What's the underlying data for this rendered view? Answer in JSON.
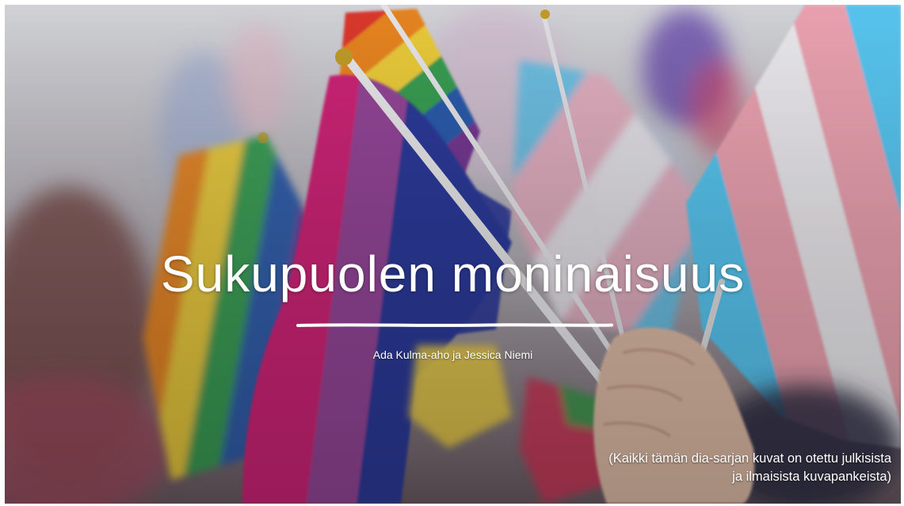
{
  "slide": {
    "title": "Sukupuolen moninaisuus",
    "subtitle": "Ada Kulma-aho ja Jessica Niemi",
    "note_line1": "(Kaikki tämän dia-sarjan kuvat on otettu julkisista",
    "note_line2": "ja ilmaisista kuvapankeista)"
  },
  "colors": {
    "title_text": "#ffffff",
    "accent_line": "#ffffff",
    "rainbow": [
      "#e43a2f",
      "#f08a24",
      "#f4d33c",
      "#3aa455",
      "#2f5fb3",
      "#7a3a98"
    ],
    "bi_flag": [
      "#d6267c",
      "#9a4a9e",
      "#2f3ca0"
    ],
    "trans_flag": [
      "#5bcefa",
      "#f5a9b8",
      "#ffffff"
    ]
  }
}
